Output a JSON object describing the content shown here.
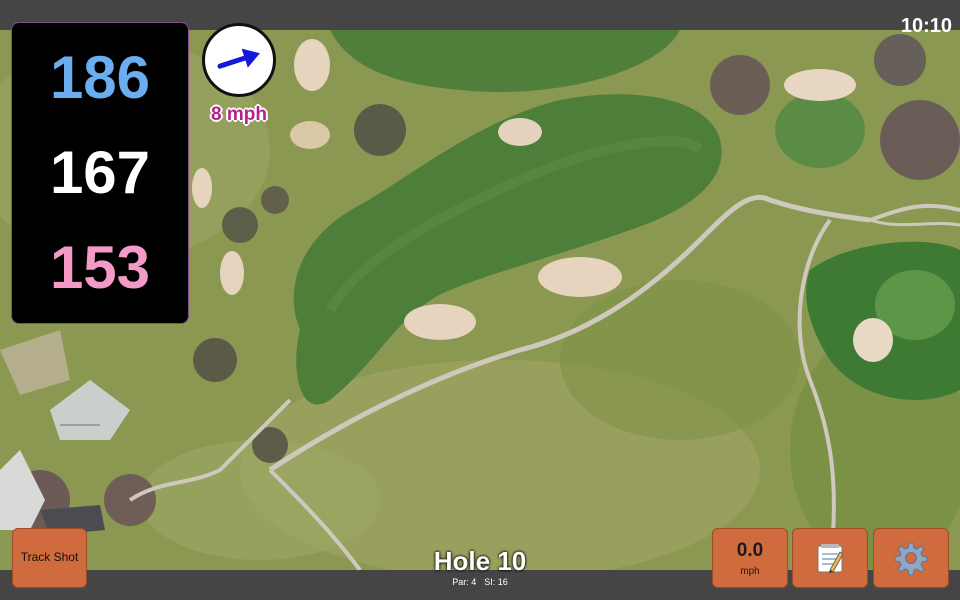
{
  "status_bar": {
    "clock": "10:10"
  },
  "distances": {
    "back": "186",
    "center": "167",
    "front": "153"
  },
  "wind": {
    "speed_label": "8 mph",
    "arrow_color": "#1418d8",
    "direction": "east-north-east"
  },
  "track_shot_button": {
    "label": "Track Shot"
  },
  "speed_button": {
    "value": "0.0",
    "unit": "mph"
  },
  "notes_button": {
    "icon": "notepad-icon"
  },
  "settings_button": {
    "icon": "gear-icon"
  },
  "hole": {
    "title": "Hole 10",
    "par": "Par: 4",
    "si": "SI: 16"
  },
  "colors": {
    "button_bg": "#cf6b3d",
    "distance_back": "#6aaef0",
    "distance_front": "#f49ac7",
    "wind_label": "#b3218e"
  }
}
